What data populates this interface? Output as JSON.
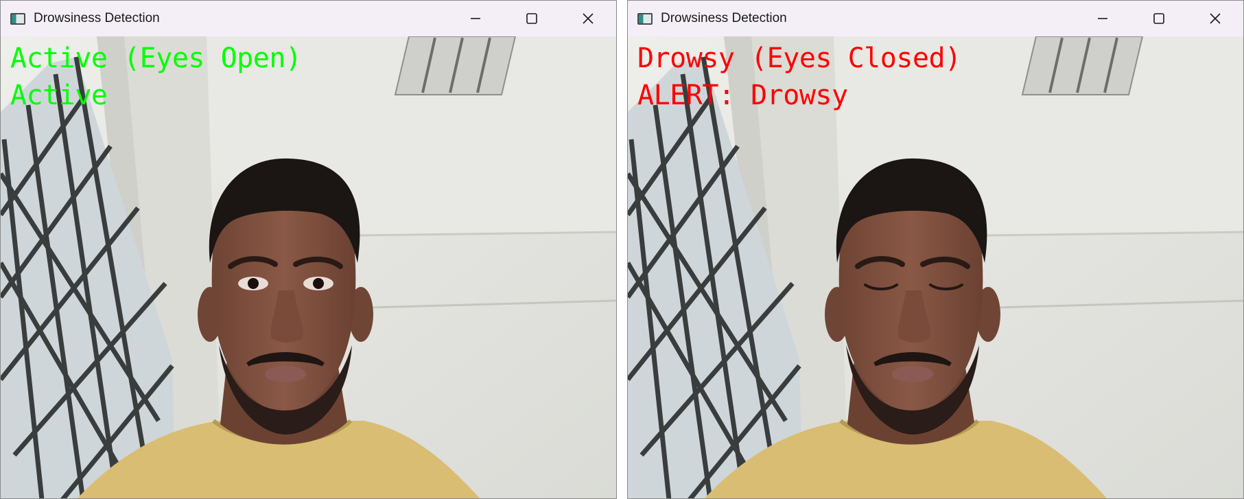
{
  "windows": [
    {
      "id": "left",
      "title": "Drowsiness Detection",
      "eyes_state": "open",
      "overlay": {
        "color": "#00ff00",
        "line1": "Active (Eyes Open)",
        "line2": "Active"
      }
    },
    {
      "id": "right",
      "title": "Drowsiness Detection",
      "eyes_state": "closed",
      "overlay": {
        "color": "#ff0000",
        "line1": "Drowsy (Eyes Closed)",
        "line2": "ALERT: Drowsy"
      }
    }
  ],
  "controls": {
    "minimize_icon": "minimize-icon",
    "maximize_icon": "maximize-icon",
    "close_icon": "close-icon"
  }
}
